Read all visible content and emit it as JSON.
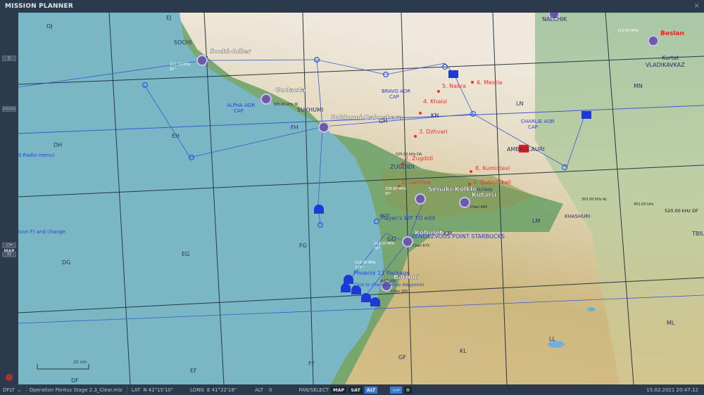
{
  "window": {
    "title": "MISSION PLANNER",
    "close": "×"
  },
  "sidebar": {
    "map_label": "MAP"
  },
  "status": {
    "profile": "DFLT",
    "mission": "Operation Pontus Stage 2.3_Clear.miz",
    "lat_label": "LAT",
    "lat": "N 42°15'10\"",
    "long_label": "LONG",
    "long": "E 41°22'18\"",
    "alt_label": "ALT",
    "alt": "0",
    "mode": "PAN/SELECT",
    "map": "MAP",
    "sat": "SAT",
    "altbtn": "ALT",
    "datetime": "15.02.2021 20:47:12"
  },
  "map": {
    "airfields": [
      "Sochi-Adler",
      "Gudauta",
      "Sukhumi-Babushara",
      "Senaki-Kolkhi",
      "Kutaisi",
      "Kobuleti",
      "Batumi",
      "Beslan"
    ],
    "cities": [
      "SOCHI",
      "SUKHUMI",
      "ZUGDIDI",
      "KUTAISI",
      "AMBROLAURI",
      "KHASHURI",
      "NALCHIK",
      "Kurtat",
      "VLADIKAVKAZ",
      "TBILISI",
      "BATUMI",
      "POTI"
    ],
    "grid": [
      "DJ",
      "EJ",
      "DH",
      "EH",
      "FH",
      "GH",
      "KN",
      "LN",
      "MN",
      "DG",
      "EG",
      "FG",
      "GG",
      "KM",
      "LM",
      "DF",
      "EF",
      "FF",
      "GF",
      "KL",
      "LL",
      "ML"
    ],
    "targets": [
      "1. Larchva",
      "2. Zugdidi",
      "3. Dzhvari",
      "4. Khaisi",
      "5. Nakra",
      "6. Mestia",
      "7. Gubistskali",
      "8. Kumistavi"
    ],
    "zones": [
      "ALPHA AOR",
      "CAP",
      "BRAVO AOR",
      "CAP",
      "CHARLIE AOR",
      "CAP"
    ],
    "notes": [
      "Player's WP TO edit",
      "RENDEZVOUS POINT STARBUCKS",
      "Phoenix 11 Package",
      "Click to change Group Waypoints",
      "0 Radio menu)",
      "icon F) and change"
    ],
    "freqs": [
      "111.10 MHz",
      "62°",
      "108.90 MHz",
      "95°",
      "111.50 MHz",
      "70°",
      "110.30 MHz",
      "120°",
      "110.50 MHz",
      "395.00 kHz XC",
      "525.00 kHz DA",
      "353.00 kHz AL",
      "452.00 kHz",
      "520.00 kHz DF",
      "Chan 67X",
      "Chan 16X",
      "Chan 44X"
    ],
    "scale": "20 nm"
  }
}
